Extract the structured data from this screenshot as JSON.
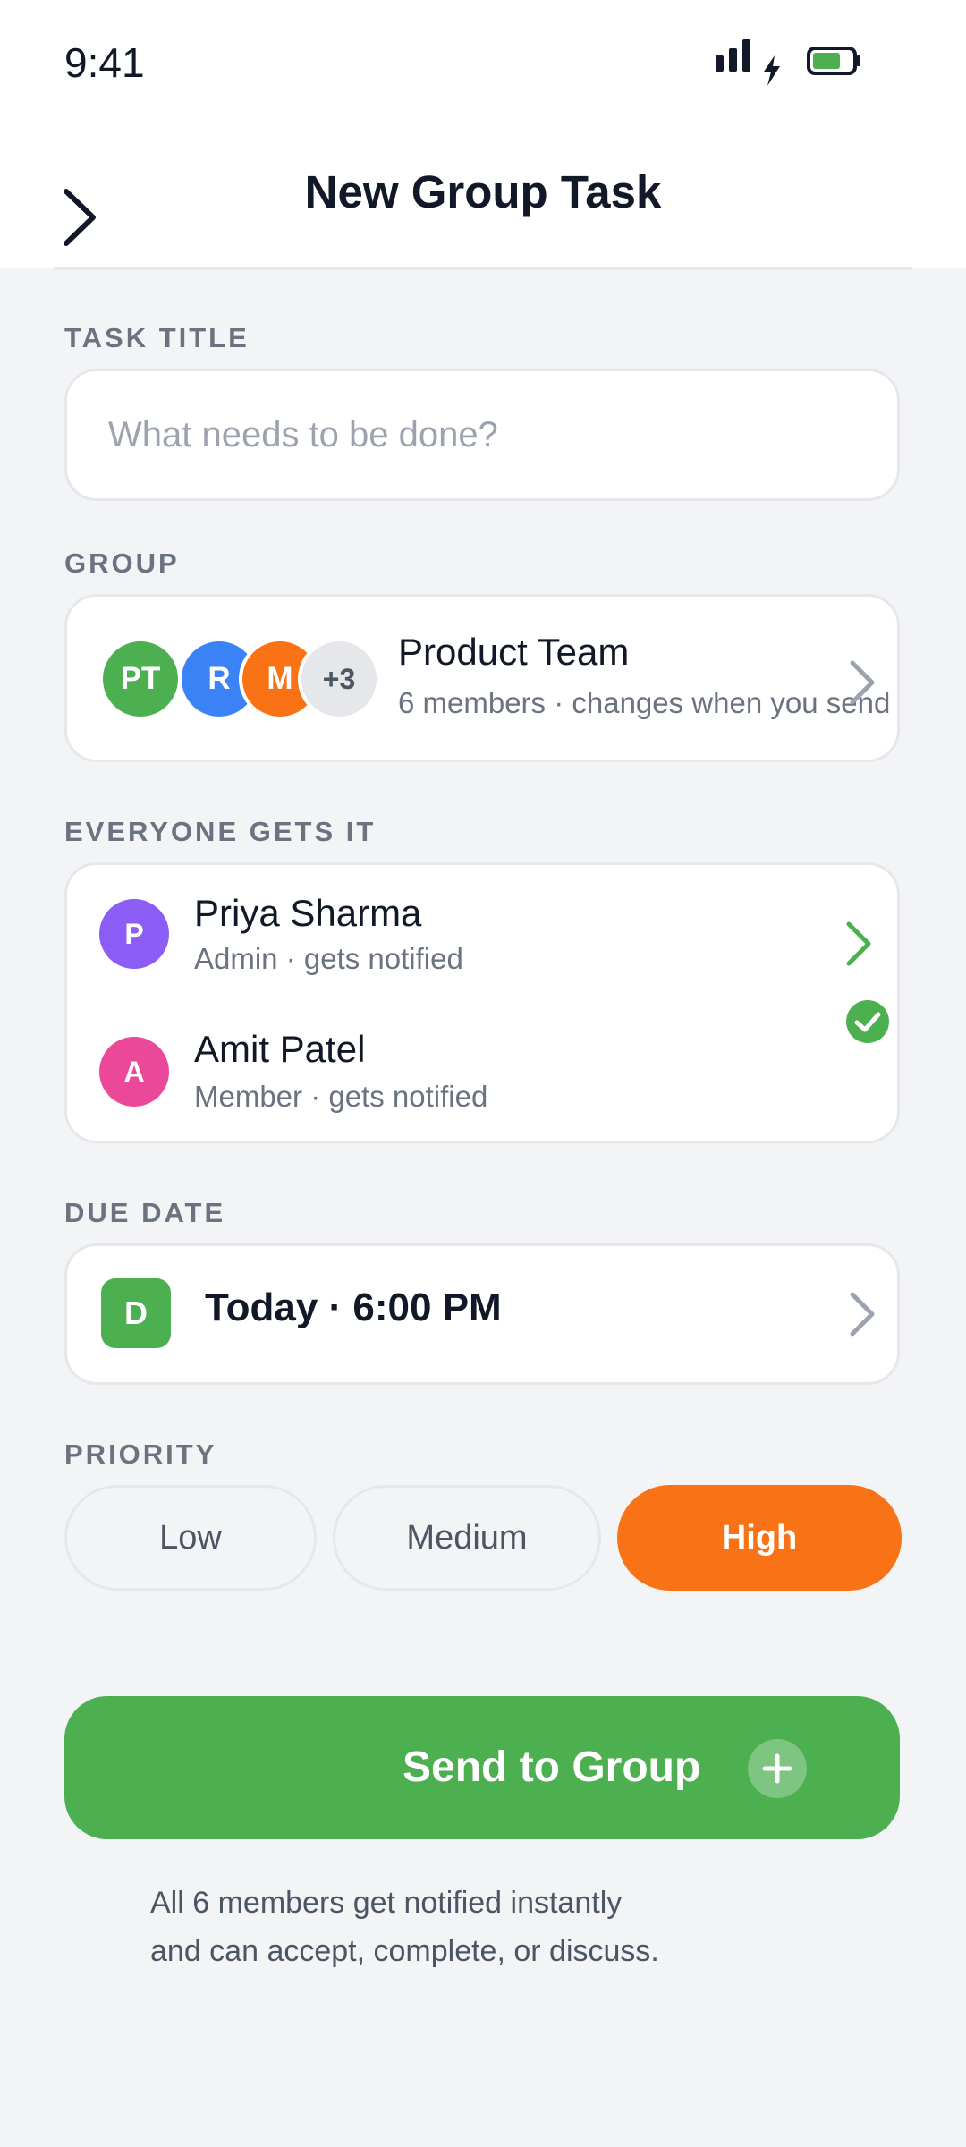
{
  "status_bar": {
    "time": "9:41"
  },
  "header": {
    "title": "New Group Task"
  },
  "task_title": {
    "label": "TASK TITLE",
    "placeholder": "What needs to be done?",
    "value": ""
  },
  "group": {
    "label": "GROUP",
    "avatars": [
      {
        "initials": "PT",
        "color": "#4caf50"
      },
      {
        "initials": "R",
        "color": "#3b82f6"
      },
      {
        "initials": "M",
        "color": "#f97316"
      }
    ],
    "overflow": "+3",
    "name": "Product Team",
    "subtitle": "6 members · changes when you send"
  },
  "everyone": {
    "label": "EVERYONE GETS IT",
    "members": [
      {
        "initial": "P",
        "name": "Priya Sharma",
        "subtitle": "Admin · gets notified",
        "color": "#8b5cf6",
        "indicator": "chevron-right-icon"
      },
      {
        "initial": "A",
        "name": "Amit Patel",
        "subtitle": "Member · gets notified",
        "color": "#ec4899",
        "indicator": "check-circle-icon"
      }
    ]
  },
  "due_date": {
    "label": "DUE DATE",
    "icon_letter": "D",
    "value": "Today · 6:00 PM"
  },
  "priority": {
    "label": "PRIORITY",
    "options": [
      "Low",
      "Medium",
      "High"
    ],
    "selected": "High"
  },
  "send_button": {
    "label": "Send to Group"
  },
  "footnote": {
    "line1": "All 6 members get notified instantly",
    "line2": "and can accept, complete, or discuss."
  },
  "colors": {
    "accent_green": "#4caf50",
    "priority_high": "#f97316",
    "muted_text": "#6b7280"
  }
}
